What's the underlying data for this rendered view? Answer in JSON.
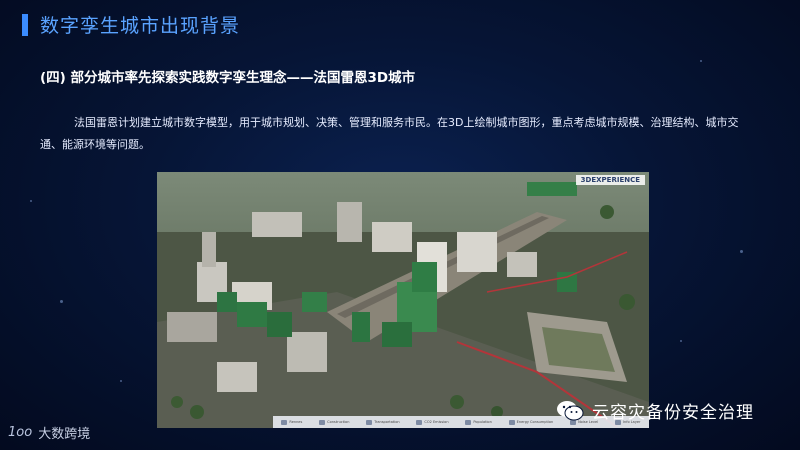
{
  "header": {
    "title": "数字孪生城市出现背景"
  },
  "section": {
    "subtitle": "(四) 部分城市率先探索实践数字孪生理念——法国雷恩3D城市"
  },
  "body": {
    "paragraph": "法国雷恩计划建立城市数字模型，用于城市规划、决策、管理和服务市民。在3D上绘制城市图形，重点考虑城市规模、治理结构、城市交通、能源环境等问题。"
  },
  "scene": {
    "brand_label": "3DEXPERIENCE",
    "toolbar_items": [
      {
        "label": "Rennes"
      },
      {
        "label": "Construction"
      },
      {
        "label": "Transportation"
      },
      {
        "label": "CO2 Emission"
      },
      {
        "label": "Population"
      },
      {
        "label": "Energy Consumption"
      },
      {
        "label": "Noise Level"
      },
      {
        "label": "Info Layer"
      }
    ]
  },
  "footer": {
    "logo_mark": "1oo",
    "logo_text": "大数跨境",
    "wechat_account": "云容灾备份安全治理"
  },
  "colors": {
    "accent": "#3b8cff",
    "title": "#5aa3ff",
    "background": "#061536"
  }
}
